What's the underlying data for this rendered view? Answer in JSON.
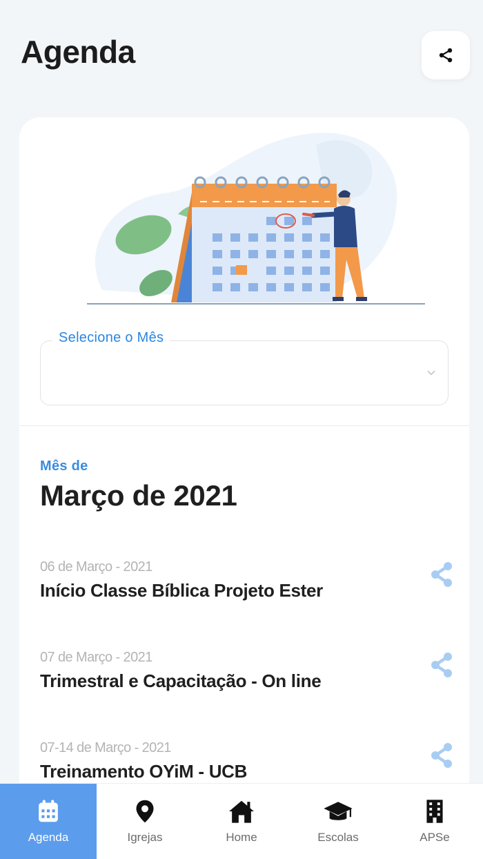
{
  "header": {
    "title": "Agenda"
  },
  "month_select": {
    "label": "Selecione o Mês",
    "value": ""
  },
  "month_section": {
    "prefix": "Mês de",
    "title": "Março de 2021"
  },
  "events": [
    {
      "date": "06 de Março - 2021",
      "title": "Início Classe Bíblica Projeto Ester"
    },
    {
      "date": "07 de Março - 2021",
      "title": "Trimestral e Capacitação - On line"
    },
    {
      "date": "07-14 de Março - 2021",
      "title": "Treinamento OYiM - UCB"
    }
  ],
  "tabs": [
    {
      "label": "Agenda",
      "icon": "calendar-icon",
      "active": true
    },
    {
      "label": "Igrejas",
      "icon": "map-pin-icon",
      "active": false
    },
    {
      "label": "Home",
      "icon": "home-icon",
      "active": false
    },
    {
      "label": "Escolas",
      "icon": "graduation-cap-icon",
      "active": false
    },
    {
      "label": "APSe",
      "icon": "building-icon",
      "active": false
    }
  ],
  "colors": {
    "accent": "#2b86e0",
    "tab_active": "#5b9cec",
    "share_icon": "#a9cdf2",
    "calendar_orange": "#f2994a"
  }
}
